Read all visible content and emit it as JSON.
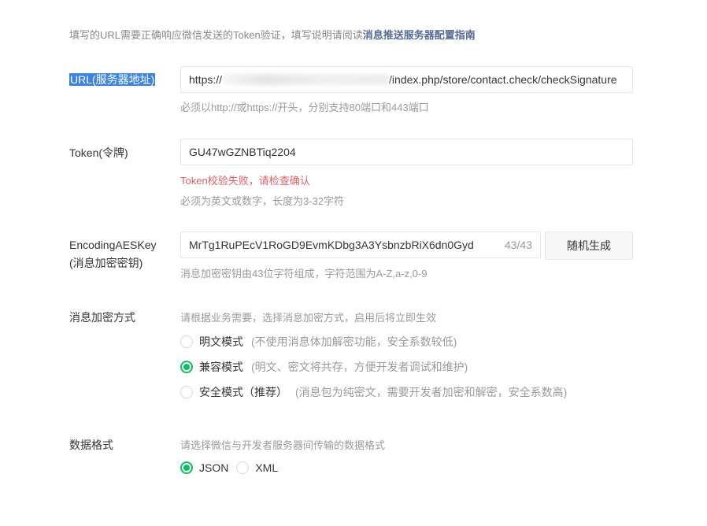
{
  "intro": {
    "text": "填写的URL需要正确响应微信发送的Token验证，填写说明请阅读",
    "link": "消息推送服务器配置指南"
  },
  "url": {
    "label": "URL(服务器地址)",
    "value_prefix": "https://",
    "value_suffix": "/index.php/store/contact.check/checkSignature",
    "hint": "必须以http://或https://开头，分别支持80端口和443端口"
  },
  "token": {
    "label": "Token(令牌)",
    "value": "GU47wGZNBTiq2204",
    "error": "Token校验失败，请检查确认",
    "hint": "必须为英文或数字，长度为3-32字符"
  },
  "aes": {
    "label_line1": "EncodingAESKey",
    "label_line2": "(消息加密密钥)",
    "value": "MrTg1RuPEcV1RoGD9EvmKDbg3A3YsbnzbRiX6dn0Gyd",
    "counter": "43/43",
    "random_button": "随机生成",
    "hint": "消息加密密钥由43位字符组成，字符范围为A-Z,a-z,0-9"
  },
  "encryption": {
    "label": "消息加密方式",
    "hint": "请根据业务需要，选择消息加密方式，启用后将立即生效",
    "options": [
      {
        "label": "明文模式",
        "desc": "(不使用消息体加解密功能，安全系数较低)",
        "checked": false
      },
      {
        "label": "兼容模式",
        "desc": "(明文、密文将共存，方便开发者调试和维护)",
        "checked": true
      },
      {
        "label": "安全模式（推荐）",
        "desc": "(消息包为纯密文，需要开发者加密和解密，安全系数高)",
        "checked": false
      }
    ]
  },
  "format": {
    "label": "数据格式",
    "hint": "请选择微信与开发者服务器间传输的数据格式",
    "options": [
      {
        "label": "JSON",
        "checked": true
      },
      {
        "label": "XML",
        "checked": false
      }
    ]
  },
  "colors": {
    "accent_green": "#07c160",
    "link_blue": "#576b95",
    "error_red": "#e15f63",
    "selection_blue": "#3b84e6"
  }
}
